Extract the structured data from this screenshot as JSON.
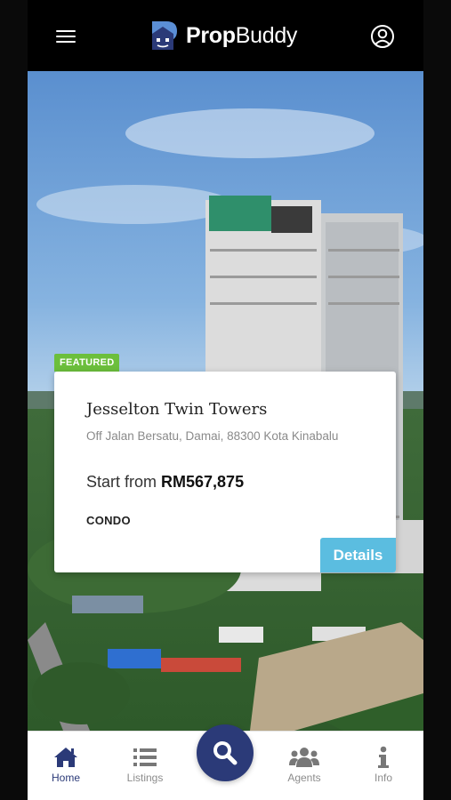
{
  "header": {
    "brand_bold": "Prop",
    "brand_light": "Buddy",
    "menu_icon": "hamburger-menu-icon",
    "profile_icon": "user-circle-icon"
  },
  "featured": {
    "badge": "FEATURED",
    "title": "Jesselton Twin Towers",
    "address": "Off Jalan Bersatu, Damai, 88300 Kota Kinabalu",
    "price_prefix": "Start from ",
    "price": "RM567,875",
    "type": "CONDO",
    "details_label": "Details"
  },
  "bottom_nav": {
    "items": [
      {
        "label": "Home",
        "icon": "home-icon",
        "active": true
      },
      {
        "label": "Listings",
        "icon": "list-icon",
        "active": false
      },
      {
        "label": "",
        "icon": "search-icon",
        "active": false
      },
      {
        "label": "Agents",
        "icon": "users-icon",
        "active": false
      },
      {
        "label": "Info",
        "icon": "info-icon",
        "active": false
      }
    ]
  },
  "colors": {
    "primary": "#2b3a78",
    "badge": "#6cbf3c",
    "details_button": "#5bbde0",
    "topbar": "#000000"
  }
}
